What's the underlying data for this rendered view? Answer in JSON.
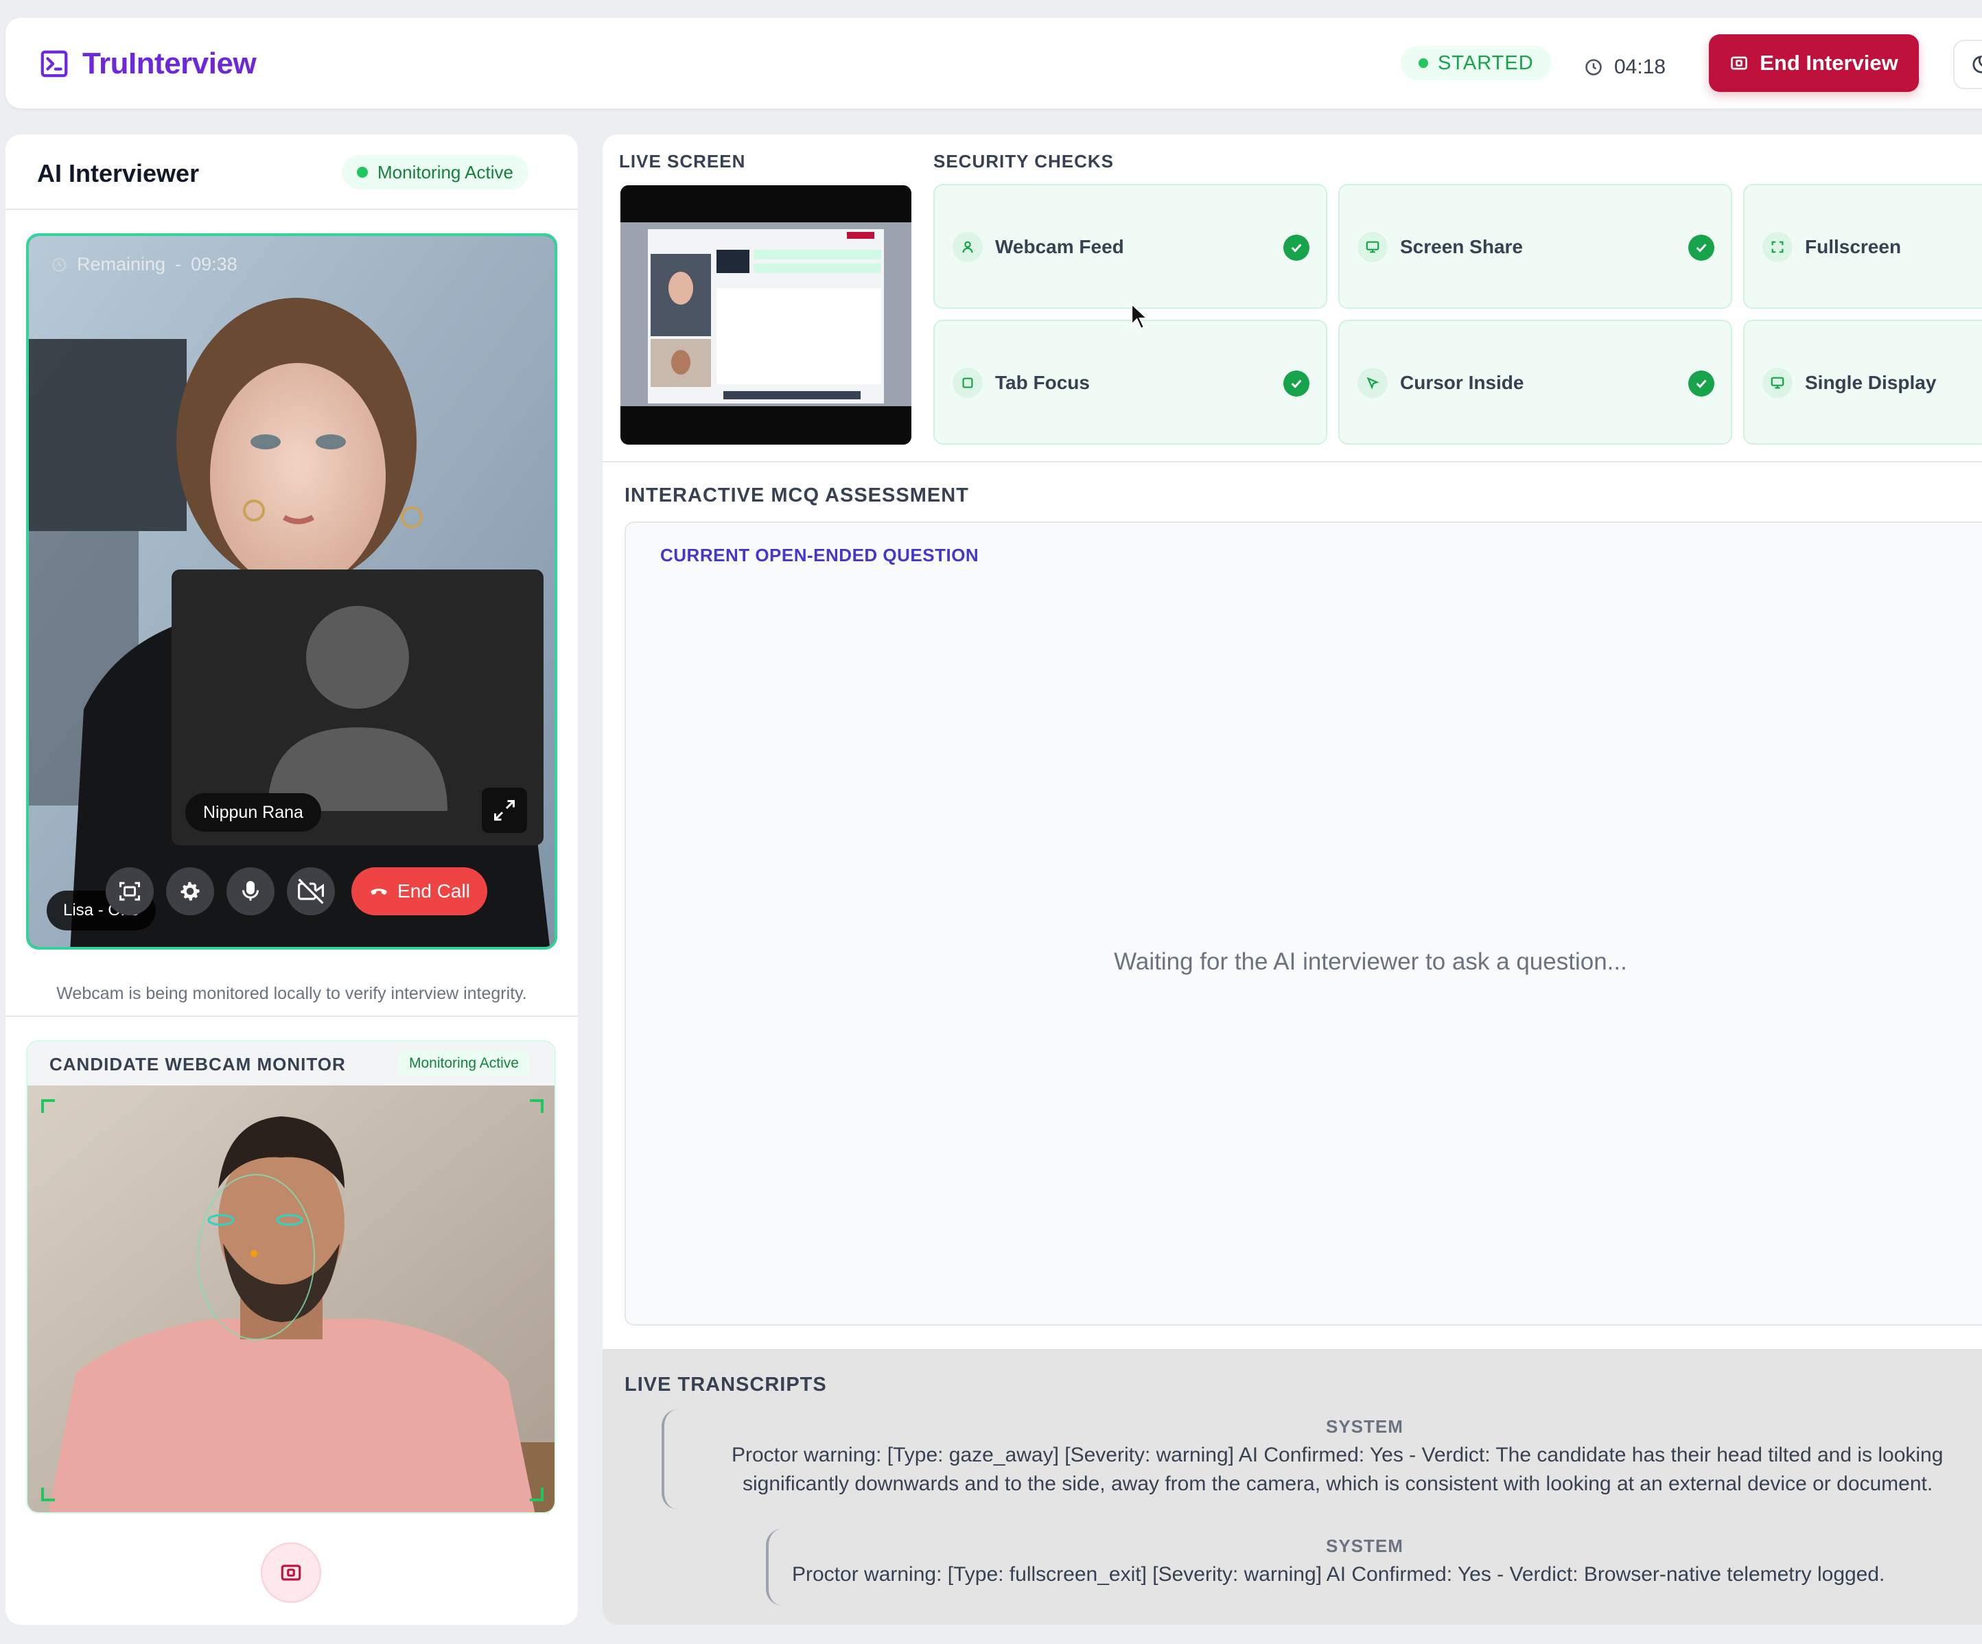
{
  "header": {
    "brand": "TruInterview",
    "status": "STARTED",
    "timer": "04:18",
    "end_label": "End Interview"
  },
  "left": {
    "title": "AI Interviewer",
    "monitoring": "Monitoring Active",
    "remaining_label": "Remaining",
    "remaining_sep": "-",
    "remaining_time": "09:38",
    "candidate_name": "Nippun Rana",
    "interviewer_name": "Lisa - One",
    "end_call": "End Call",
    "webcam_note": "Webcam is being monitored locally to verify interview integrity.",
    "cand_title": "CANDIDATE WEBCAM MONITOR",
    "cand_badge": "Monitoring Active"
  },
  "right": {
    "live_screen": "LIVE SCREEN",
    "security_checks": "SECURITY CHECKS",
    "checks": [
      {
        "label": "Webcam Feed",
        "icon": "user-icon",
        "ok": true
      },
      {
        "label": "Screen Share",
        "icon": "monitor-icon",
        "ok": true
      },
      {
        "label": "Fullscreen",
        "icon": "expand-icon",
        "ok": true
      },
      {
        "label": "Tab Focus",
        "icon": "square-icon",
        "ok": true
      },
      {
        "label": "Cursor Inside",
        "icon": "pointer-icon",
        "ok": true
      },
      {
        "label": "Single Display",
        "icon": "monitor-icon",
        "ok": true
      }
    ],
    "mcq_title": "INTERACTIVE MCQ ASSESSMENT",
    "question_label": "CURRENT OPEN-ENDED QUESTION",
    "waiting": "Waiting for the AI interviewer to ask a question...",
    "transcripts_title": "LIVE TRANSCRIPTS",
    "transcripts": [
      {
        "role": "SYSTEM",
        "line1": "Proctor warning: [Type: gaze_away] [Severity: warning] AI Confirmed: Yes - Verdict: The candidate has their head tilted and is looking",
        "line2": "significantly downwards and to the side, away from the camera, which is consistent with looking at an external device or document."
      },
      {
        "role": "SYSTEM",
        "line1": "Proctor warning: [Type: fullscreen_exit] [Severity: warning] AI Confirmed: Yes - Verdict: Browser-native telemetry logged."
      }
    ]
  },
  "colors": {
    "brand": "#6d28d9",
    "danger": "#be123c",
    "success": "#16a34a",
    "accent_green": "#34d399"
  }
}
